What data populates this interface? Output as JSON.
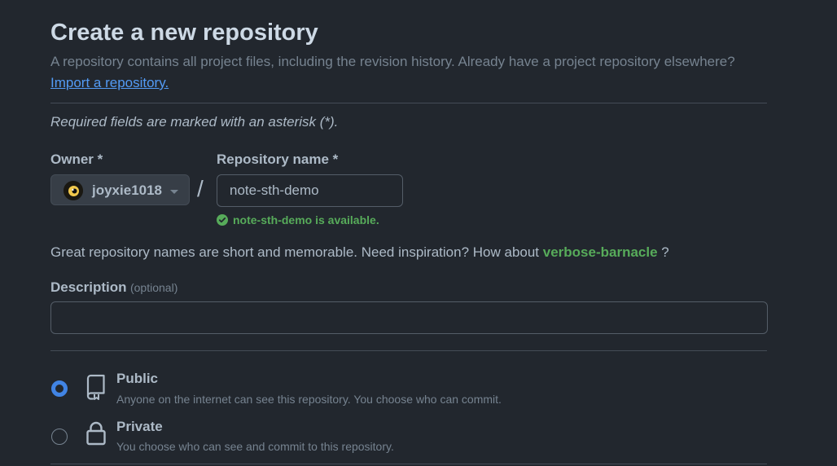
{
  "header": {
    "title": "Create a new repository",
    "subtitle": "A repository contains all project files, including the revision history. Already have a project repository elsewhere?",
    "import_link": "Import a repository."
  },
  "form": {
    "required_note": "Required fields are marked with an asterisk (*).",
    "owner": {
      "label": "Owner *",
      "value": "joyxie1018"
    },
    "separator": "/",
    "repo_name": {
      "label": "Repository name *",
      "value": "note-sth-demo",
      "availability": "note-sth-demo is available."
    },
    "inspiration": {
      "text": "Great repository names are short and memorable. Need inspiration? How about",
      "suggestion": "verbose-barnacle",
      "suffix": "?"
    },
    "description": {
      "label": "Description",
      "optional": "(optional)",
      "value": ""
    },
    "visibility": [
      {
        "title": "Public",
        "description": "Anyone on the internet can see this repository. You choose who can commit.",
        "selected": true,
        "icon": "repo-icon"
      },
      {
        "title": "Private",
        "description": "You choose who can see and commit to this repository.",
        "selected": false,
        "icon": "lock-icon"
      }
    ]
  },
  "colors": {
    "background": "#22272e",
    "accent_blue": "#539bf5",
    "success_green": "#57ab5a",
    "radio_blue": "#4184e4"
  }
}
